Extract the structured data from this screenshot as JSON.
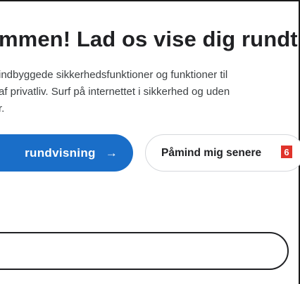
{
  "welcome": {
    "title": "mmen! Lad os vise dig rundt",
    "description": "indbyggede sikkerhedsfunktioner og funktioner til\naf privatliv. Surf på internettet i sikkerhed og uden\nr."
  },
  "actions": {
    "tour_label": "rundvisning",
    "tour_arrow": "→",
    "remind_label": "Påmind mig senere",
    "remind_badge": "6"
  },
  "colors": {
    "accent": "#1a6ec8",
    "badge": "#e0332b"
  },
  "icons": {
    "tour_arrow": "arrow-right-icon"
  }
}
